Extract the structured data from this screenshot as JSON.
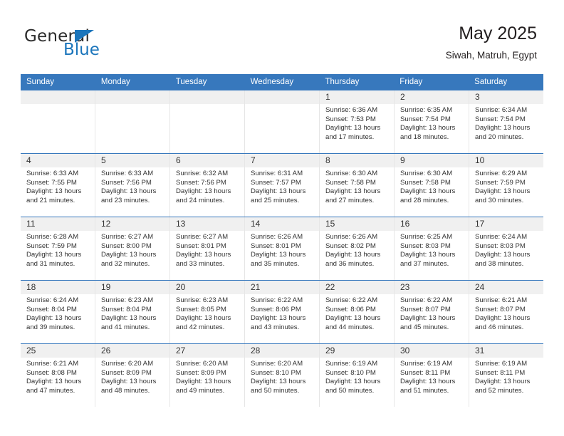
{
  "logo": {
    "line1": "General",
    "line2": "Blue",
    "triangle_color": "#1b75bb",
    "text_color": "#2b2b2b"
  },
  "header": {
    "title": "May 2025",
    "subtitle": "Siwah, Matruh, Egypt"
  },
  "theme": {
    "header_blue": "#3778bd",
    "daynum_band": "#f0f0f0",
    "text": "#333333"
  },
  "weekday_headers": [
    "Sunday",
    "Monday",
    "Tuesday",
    "Wednesday",
    "Thursday",
    "Friday",
    "Saturday"
  ],
  "weeks": [
    [
      {
        "day": "",
        "sunrise": "",
        "sunset": "",
        "daylight_line1": "",
        "daylight_line2": ""
      },
      {
        "day": "",
        "sunrise": "",
        "sunset": "",
        "daylight_line1": "",
        "daylight_line2": ""
      },
      {
        "day": "",
        "sunrise": "",
        "sunset": "",
        "daylight_line1": "",
        "daylight_line2": ""
      },
      {
        "day": "",
        "sunrise": "",
        "sunset": "",
        "daylight_line1": "",
        "daylight_line2": ""
      },
      {
        "day": "1",
        "sunrise": "Sunrise: 6:36 AM",
        "sunset": "Sunset: 7:53 PM",
        "daylight_line1": "Daylight: 13 hours",
        "daylight_line2": "and 17 minutes."
      },
      {
        "day": "2",
        "sunrise": "Sunrise: 6:35 AM",
        "sunset": "Sunset: 7:54 PM",
        "daylight_line1": "Daylight: 13 hours",
        "daylight_line2": "and 18 minutes."
      },
      {
        "day": "3",
        "sunrise": "Sunrise: 6:34 AM",
        "sunset": "Sunset: 7:54 PM",
        "daylight_line1": "Daylight: 13 hours",
        "daylight_line2": "and 20 minutes."
      }
    ],
    [
      {
        "day": "4",
        "sunrise": "Sunrise: 6:33 AM",
        "sunset": "Sunset: 7:55 PM",
        "daylight_line1": "Daylight: 13 hours",
        "daylight_line2": "and 21 minutes."
      },
      {
        "day": "5",
        "sunrise": "Sunrise: 6:33 AM",
        "sunset": "Sunset: 7:56 PM",
        "daylight_line1": "Daylight: 13 hours",
        "daylight_line2": "and 23 minutes."
      },
      {
        "day": "6",
        "sunrise": "Sunrise: 6:32 AM",
        "sunset": "Sunset: 7:56 PM",
        "daylight_line1": "Daylight: 13 hours",
        "daylight_line2": "and 24 minutes."
      },
      {
        "day": "7",
        "sunrise": "Sunrise: 6:31 AM",
        "sunset": "Sunset: 7:57 PM",
        "daylight_line1": "Daylight: 13 hours",
        "daylight_line2": "and 25 minutes."
      },
      {
        "day": "8",
        "sunrise": "Sunrise: 6:30 AM",
        "sunset": "Sunset: 7:58 PM",
        "daylight_line1": "Daylight: 13 hours",
        "daylight_line2": "and 27 minutes."
      },
      {
        "day": "9",
        "sunrise": "Sunrise: 6:30 AM",
        "sunset": "Sunset: 7:58 PM",
        "daylight_line1": "Daylight: 13 hours",
        "daylight_line2": "and 28 minutes."
      },
      {
        "day": "10",
        "sunrise": "Sunrise: 6:29 AM",
        "sunset": "Sunset: 7:59 PM",
        "daylight_line1": "Daylight: 13 hours",
        "daylight_line2": "and 30 minutes."
      }
    ],
    [
      {
        "day": "11",
        "sunrise": "Sunrise: 6:28 AM",
        "sunset": "Sunset: 7:59 PM",
        "daylight_line1": "Daylight: 13 hours",
        "daylight_line2": "and 31 minutes."
      },
      {
        "day": "12",
        "sunrise": "Sunrise: 6:27 AM",
        "sunset": "Sunset: 8:00 PM",
        "daylight_line1": "Daylight: 13 hours",
        "daylight_line2": "and 32 minutes."
      },
      {
        "day": "13",
        "sunrise": "Sunrise: 6:27 AM",
        "sunset": "Sunset: 8:01 PM",
        "daylight_line1": "Daylight: 13 hours",
        "daylight_line2": "and 33 minutes."
      },
      {
        "day": "14",
        "sunrise": "Sunrise: 6:26 AM",
        "sunset": "Sunset: 8:01 PM",
        "daylight_line1": "Daylight: 13 hours",
        "daylight_line2": "and 35 minutes."
      },
      {
        "day": "15",
        "sunrise": "Sunrise: 6:26 AM",
        "sunset": "Sunset: 8:02 PM",
        "daylight_line1": "Daylight: 13 hours",
        "daylight_line2": "and 36 minutes."
      },
      {
        "day": "16",
        "sunrise": "Sunrise: 6:25 AM",
        "sunset": "Sunset: 8:03 PM",
        "daylight_line1": "Daylight: 13 hours",
        "daylight_line2": "and 37 minutes."
      },
      {
        "day": "17",
        "sunrise": "Sunrise: 6:24 AM",
        "sunset": "Sunset: 8:03 PM",
        "daylight_line1": "Daylight: 13 hours",
        "daylight_line2": "and 38 minutes."
      }
    ],
    [
      {
        "day": "18",
        "sunrise": "Sunrise: 6:24 AM",
        "sunset": "Sunset: 8:04 PM",
        "daylight_line1": "Daylight: 13 hours",
        "daylight_line2": "and 39 minutes."
      },
      {
        "day": "19",
        "sunrise": "Sunrise: 6:23 AM",
        "sunset": "Sunset: 8:04 PM",
        "daylight_line1": "Daylight: 13 hours",
        "daylight_line2": "and 41 minutes."
      },
      {
        "day": "20",
        "sunrise": "Sunrise: 6:23 AM",
        "sunset": "Sunset: 8:05 PM",
        "daylight_line1": "Daylight: 13 hours",
        "daylight_line2": "and 42 minutes."
      },
      {
        "day": "21",
        "sunrise": "Sunrise: 6:22 AM",
        "sunset": "Sunset: 8:06 PM",
        "daylight_line1": "Daylight: 13 hours",
        "daylight_line2": "and 43 minutes."
      },
      {
        "day": "22",
        "sunrise": "Sunrise: 6:22 AM",
        "sunset": "Sunset: 8:06 PM",
        "daylight_line1": "Daylight: 13 hours",
        "daylight_line2": "and 44 minutes."
      },
      {
        "day": "23",
        "sunrise": "Sunrise: 6:22 AM",
        "sunset": "Sunset: 8:07 PM",
        "daylight_line1": "Daylight: 13 hours",
        "daylight_line2": "and 45 minutes."
      },
      {
        "day": "24",
        "sunrise": "Sunrise: 6:21 AM",
        "sunset": "Sunset: 8:07 PM",
        "daylight_line1": "Daylight: 13 hours",
        "daylight_line2": "and 46 minutes."
      }
    ],
    [
      {
        "day": "25",
        "sunrise": "Sunrise: 6:21 AM",
        "sunset": "Sunset: 8:08 PM",
        "daylight_line1": "Daylight: 13 hours",
        "daylight_line2": "and 47 minutes."
      },
      {
        "day": "26",
        "sunrise": "Sunrise: 6:20 AM",
        "sunset": "Sunset: 8:09 PM",
        "daylight_line1": "Daylight: 13 hours",
        "daylight_line2": "and 48 minutes."
      },
      {
        "day": "27",
        "sunrise": "Sunrise: 6:20 AM",
        "sunset": "Sunset: 8:09 PM",
        "daylight_line1": "Daylight: 13 hours",
        "daylight_line2": "and 49 minutes."
      },
      {
        "day": "28",
        "sunrise": "Sunrise: 6:20 AM",
        "sunset": "Sunset: 8:10 PM",
        "daylight_line1": "Daylight: 13 hours",
        "daylight_line2": "and 50 minutes."
      },
      {
        "day": "29",
        "sunrise": "Sunrise: 6:19 AM",
        "sunset": "Sunset: 8:10 PM",
        "daylight_line1": "Daylight: 13 hours",
        "daylight_line2": "and 50 minutes."
      },
      {
        "day": "30",
        "sunrise": "Sunrise: 6:19 AM",
        "sunset": "Sunset: 8:11 PM",
        "daylight_line1": "Daylight: 13 hours",
        "daylight_line2": "and 51 minutes."
      },
      {
        "day": "31",
        "sunrise": "Sunrise: 6:19 AM",
        "sunset": "Sunset: 8:11 PM",
        "daylight_line1": "Daylight: 13 hours",
        "daylight_line2": "and 52 minutes."
      }
    ]
  ]
}
